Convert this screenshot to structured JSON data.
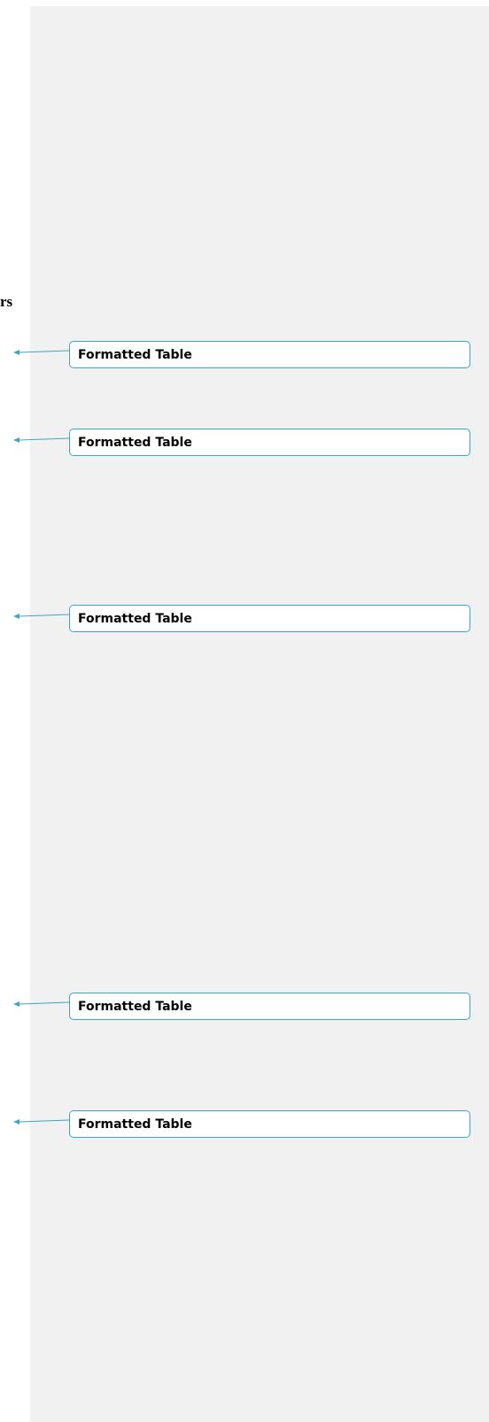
{
  "document": {
    "visible_text_fragment": "rs"
  },
  "markup_pane": {
    "accent_color": "#3aa8c1",
    "background_color": "#f1f1f1",
    "balloons": [
      {
        "label": "Formatted Table"
      },
      {
        "label": "Formatted Table"
      },
      {
        "label": "Formatted Table"
      },
      {
        "label": "Formatted Table"
      },
      {
        "label": "Formatted Table"
      }
    ]
  }
}
